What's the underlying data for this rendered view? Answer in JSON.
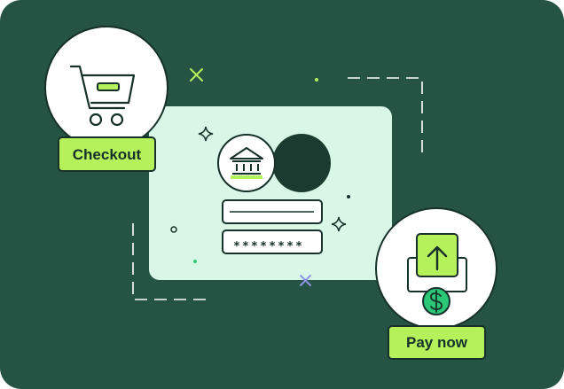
{
  "checkout": {
    "label": "Checkout"
  },
  "pay": {
    "label": "Pay now"
  },
  "card": {
    "password_mask": "********"
  },
  "icons": {
    "cart": "shopping-cart-icon",
    "bank": "bank-icon",
    "upload": "upload-arrow-icon",
    "dollar": "dollar-coin-icon"
  },
  "colors": {
    "background": "#255444",
    "panel": "#d9f7e6",
    "accent": "#b5f15b",
    "outline": "#16302a",
    "dark_circle": "#1b3a30",
    "coin": "#2bc878",
    "sparkle_lime": "#b6f05a",
    "sparkle_purple": "#8f95e8"
  }
}
